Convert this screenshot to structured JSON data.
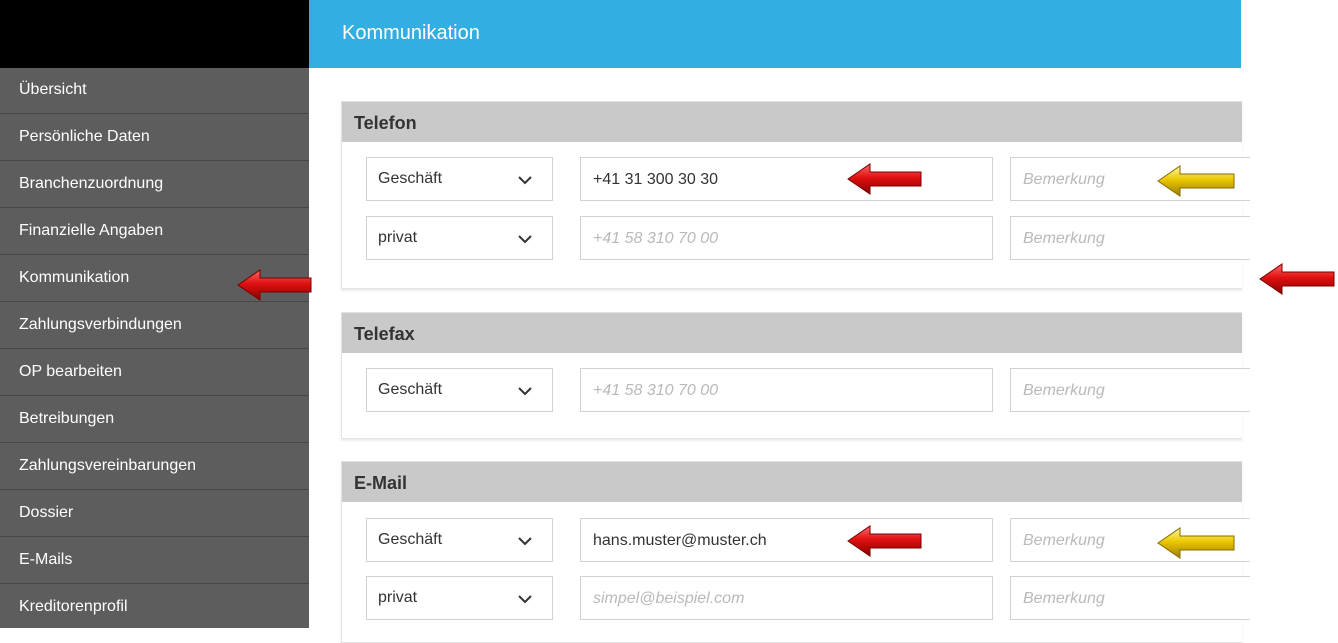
{
  "header": {
    "title": "Kommunikation"
  },
  "sidebar": {
    "items": [
      {
        "label": "Übersicht"
      },
      {
        "label": "Persönliche Daten"
      },
      {
        "label": "Branchenzuordnung"
      },
      {
        "label": "Finanzielle Angaben"
      },
      {
        "label": "Kommunikation"
      },
      {
        "label": "Zahlungsverbindungen"
      },
      {
        "label": "OP bearbeiten"
      },
      {
        "label": "Betreibungen"
      },
      {
        "label": "Zahlungsvereinbarungen"
      },
      {
        "label": "Dossier"
      },
      {
        "label": "E-Mails"
      },
      {
        "label": "Kreditorenprofil"
      }
    ]
  },
  "sections": {
    "telefon": {
      "title": "Telefon",
      "rows": [
        {
          "type": "Geschäft",
          "value": "+41 31 300 30 30",
          "placeholder": "",
          "note_placeholder": "Bemerkung"
        },
        {
          "type": "privat",
          "value": "",
          "placeholder": "+41 58 310 70 00",
          "note_placeholder": "Bemerkung"
        }
      ]
    },
    "telefax": {
      "title": "Telefax",
      "rows": [
        {
          "type": "Geschäft",
          "value": "",
          "placeholder": "+41 58 310 70 00",
          "note_placeholder": "Bemerkung"
        }
      ]
    },
    "email": {
      "title": "E-Mail",
      "rows": [
        {
          "type": "Geschäft",
          "value": "hans.muster@muster.ch",
          "placeholder": "",
          "note_placeholder": "Bemerkung"
        },
        {
          "type": "privat",
          "value": "",
          "placeholder": "simpel@beispiel.com",
          "note_placeholder": "Bemerkung"
        }
      ]
    }
  },
  "colors": {
    "header_bg": "#33aee2",
    "sidebar_bg": "#5d5d5d",
    "section_head_bg": "#c9c9c9",
    "arrow_red": "#e01010",
    "arrow_yellow": "#e8c400"
  },
  "icons": {
    "dropdown": "chevron-down-icon",
    "annotation_red": "red-arrow-icon",
    "annotation_yellow": "yellow-arrow-icon"
  }
}
